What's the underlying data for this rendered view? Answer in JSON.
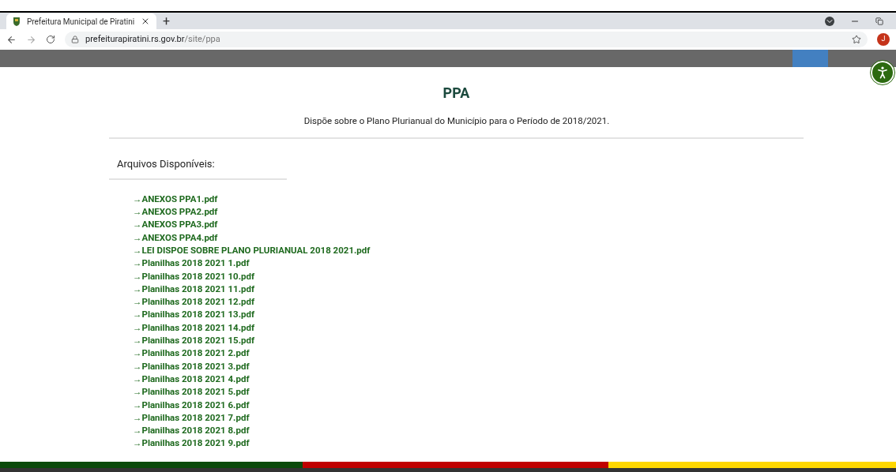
{
  "browser": {
    "tab": {
      "title": "Prefeitura Municipal de Piratini",
      "selected": true
    },
    "new_tab": "+",
    "url": {
      "host": "prefeiturapiratini.rs.gov.br",
      "path": "/site/ppa"
    },
    "profile_initial": "J"
  },
  "page": {
    "title": "PPA",
    "description": "Dispõe sobre o Plano Plurianual do Município para o Período de 2018/2021.",
    "files_heading": "Arquivos Disponíveis:",
    "files": [
      "→ANEXOS PPA1.pdf",
      "→ANEXOS PPA2.pdf",
      "→ANEXOS PPA3.pdf",
      "→ANEXOS PPA4.pdf",
      "→LEI DISPOE SOBRE PLANO PLURIANUAL 2018 2021.pdf",
      "→Planilhas 2018 2021 1.pdf",
      "→Planilhas 2018 2021 10.pdf",
      "→Planilhas 2018 2021 11.pdf",
      "→Planilhas 2018 2021 12.pdf",
      "→Planilhas 2018 2021 13.pdf",
      "→Planilhas 2018 2021 14.pdf",
      "→Planilhas 2018 2021 15.pdf",
      "→Planilhas 2018 2021 2.pdf",
      "→Planilhas 2018 2021 3.pdf",
      "→Planilhas 2018 2021 4.pdf",
      "→Planilhas 2018 2021 5.pdf",
      "→Planilhas 2018 2021 6.pdf",
      "→Planilhas 2018 2021 7.pdf",
      "→Planilhas 2018 2021 8.pdf",
      "→Planilhas 2018 2021 9.pdf"
    ]
  }
}
